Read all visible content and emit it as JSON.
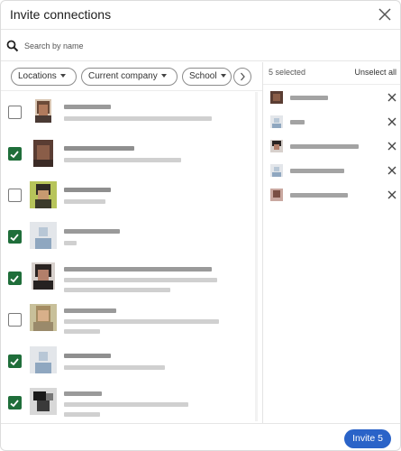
{
  "dialog": {
    "title": "Invite connections"
  },
  "search": {
    "placeholder": "Search by name",
    "value": ""
  },
  "filters": [
    {
      "label": "Locations"
    },
    {
      "label": "Current company"
    },
    {
      "label": "School"
    }
  ],
  "connections": [
    {
      "checked": false
    },
    {
      "checked": true
    },
    {
      "checked": false
    },
    {
      "checked": true
    },
    {
      "checked": true
    },
    {
      "checked": false
    },
    {
      "checked": true
    },
    {
      "checked": true
    }
  ],
  "selection": {
    "count_label": "5 selected",
    "unselect_all_label": "Unselect all",
    "count": 5
  },
  "footer": {
    "invite_label": "Invite 5"
  },
  "colors": {
    "accent": "#2a63c8",
    "checkbox_checked": "#1f6e3a",
    "blurred_text": "#c4c4c4"
  },
  "icons": {
    "close": "close-icon",
    "search": "search-icon",
    "next": "chevron-right-icon",
    "remove": "remove-icon"
  }
}
